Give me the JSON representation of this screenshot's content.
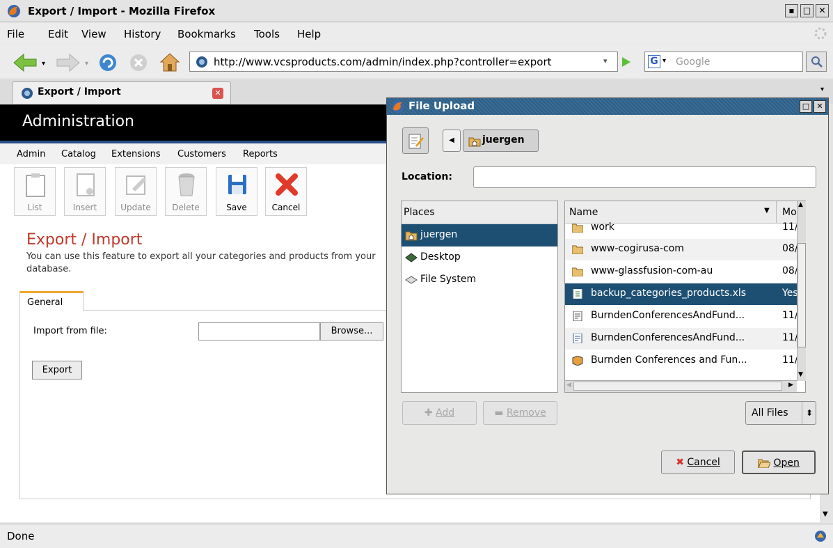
{
  "window": {
    "title": "Export / Import - Mozilla Firefox"
  },
  "menubar": {
    "items": [
      {
        "label": "File",
        "accel": "F"
      },
      {
        "label": "Edit",
        "accel": "E"
      },
      {
        "label": "View",
        "accel": "V"
      },
      {
        "label": "History",
        "accel": "s"
      },
      {
        "label": "Bookmarks",
        "accel": "B"
      },
      {
        "label": "Tools",
        "accel": "T"
      },
      {
        "label": "Help",
        "accel": "H"
      }
    ]
  },
  "navbar": {
    "url": "http://www.vcsproducts.com/admin/index.php?controller=export",
    "search_placeholder": "Google"
  },
  "tab": {
    "label": "Export / Import"
  },
  "admin": {
    "title": "Administration",
    "menu": [
      "Admin",
      "Catalog",
      "Extensions",
      "Customers",
      "Reports"
    ],
    "toolbar": [
      {
        "label": "List",
        "enabled": false
      },
      {
        "label": "Insert",
        "enabled": false
      },
      {
        "label": "Update",
        "enabled": false
      },
      {
        "label": "Delete",
        "enabled": false
      },
      {
        "label": "Save",
        "enabled": true
      },
      {
        "label": "Cancel",
        "enabled": true
      }
    ]
  },
  "page": {
    "heading": "Export / Import",
    "description": "You can use this feature to export all your categories and products from your database.",
    "tab_label": "General",
    "import_label": "Import from file:",
    "browse_label": "Browse...",
    "export_label": "Export"
  },
  "status": {
    "text": "Done"
  },
  "dialog": {
    "title": "File Upload",
    "path_button": "juergen",
    "location_label": "Location:",
    "location_value": "",
    "places_header": "Places",
    "places": [
      {
        "label": "juergen",
        "icon": "home-folder-icon",
        "selected": true
      },
      {
        "label": "Desktop",
        "icon": "desktop-icon",
        "selected": false
      },
      {
        "label": "File System",
        "icon": "drive-icon",
        "selected": false
      }
    ],
    "files_header_name": "Name",
    "files_header_modified": "Mo",
    "files": [
      {
        "name": "work",
        "modified": "11/",
        "icon": "folder-icon",
        "selected": false
      },
      {
        "name": "www-cogirusa-com",
        "modified": "08/",
        "icon": "folder-icon",
        "selected": false
      },
      {
        "name": "www-glassfusion-com-au",
        "modified": "08/",
        "icon": "folder-icon",
        "selected": false
      },
      {
        "name": "backup_categories_products.xls",
        "modified": "Yes",
        "icon": "spreadsheet-icon",
        "selected": true
      },
      {
        "name": "BurndenConferencesAndFund...",
        "modified": "11/",
        "icon": "document-icon",
        "selected": false
      },
      {
        "name": "BurndenConferencesAndFund...",
        "modified": "11/",
        "icon": "document-icon",
        "selected": false
      },
      {
        "name": "Burnden Conferences and Fun...",
        "modified": "11/",
        "icon": "presentation-icon",
        "selected": false
      }
    ],
    "add_label": "Add",
    "remove_label": "Remove",
    "filter_label": "All Files",
    "cancel_label": "Cancel",
    "open_label": "Open"
  }
}
